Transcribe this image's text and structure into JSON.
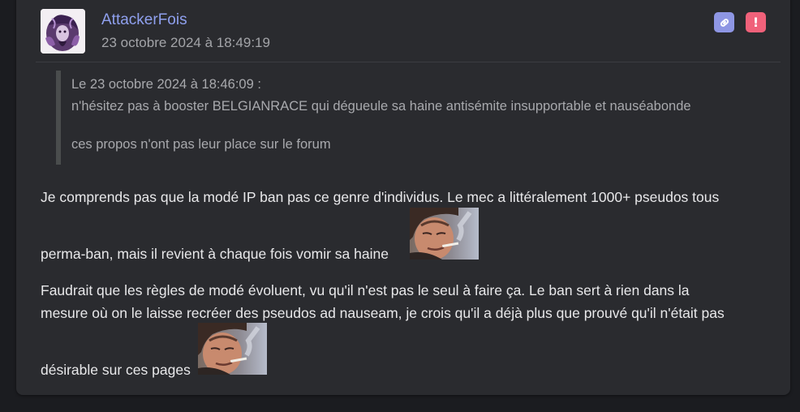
{
  "post": {
    "author": "AttackerFois",
    "timestamp": "23 octobre 2024 à 18:49:19",
    "actions": {
      "permalink_icon": "link-icon",
      "report_icon": "exclamation-icon",
      "report_symbol": "!"
    },
    "quote": {
      "header": "Le 23 octobre 2024 à 18:46:09 :",
      "line1": "n'hésitez pas à booster BELGIANRACE qui dégueule sa haine antisémite insupportable et nauséabonde",
      "line2": "ces propos n'ont pas leur place sur le forum"
    },
    "body": {
      "p1_line1": "Je comprends pas que la modé IP ban pas ce genre d'individus. Le mec a littéralement 1000+ pseudos tous",
      "p1_line2": "perma-ban, mais il revient à chaque fois vomir sa haine",
      "p2_line1": "Faudrait que les règles de modé évoluent, vu qu'il n'est pas le seul à faire ça. Le ban sert à rien dans la",
      "p2_line2": "mesure où on le laisse recréer des pseudos ad nauseam, je crois qu'il a déjà plus que prouvé qu'il n'était pas",
      "p2_line3": "désirable sur ces pages"
    }
  },
  "colors": {
    "page_bg": "#1b1c20",
    "card_bg": "#2a2b2f",
    "username": "#8fa0ee",
    "link_button": "#8e96e4",
    "report_button": "#f0617a",
    "quote_border": "#4a4d4d"
  }
}
